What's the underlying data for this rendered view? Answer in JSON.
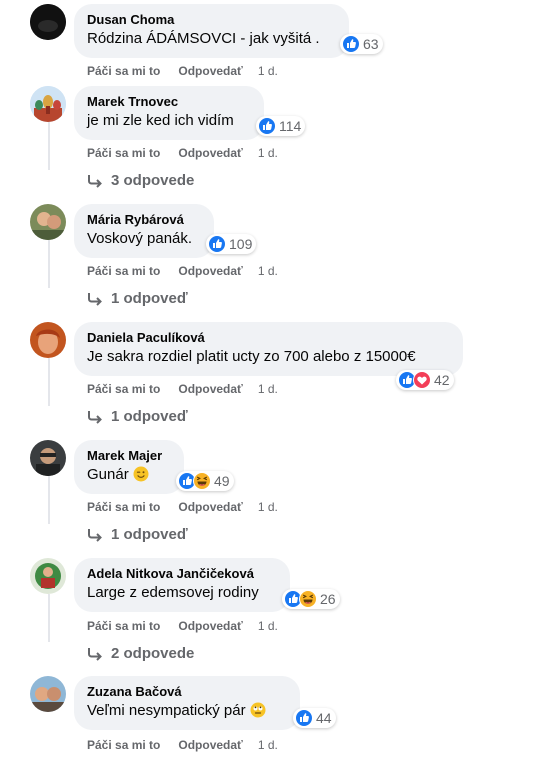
{
  "actions": {
    "like": "Páči sa mi to",
    "reply": "Odpovedať"
  },
  "colors": {
    "like_blue": "#1877f2",
    "love_red": "#f33e58",
    "haha_yellow": "#f7b125",
    "secondary_text": "#65676b",
    "bubble_bg": "#f0f2f5"
  },
  "comments": [
    {
      "author": "Dusan Choma",
      "text": "Ródzina ÁDÁMSOVCI - jak vyšitá .",
      "reactions": [
        "like"
      ],
      "count": "63",
      "time": "1 d.",
      "replies": ""
    },
    {
      "author": "Marek Trnovec",
      "text": "je mi zle ked ich vidím",
      "reactions": [
        "like"
      ],
      "count": "114",
      "time": "1 d.",
      "replies": "3 odpovede"
    },
    {
      "author": "Mária Rybárová",
      "text": "Voskový panák.",
      "reactions": [
        "like"
      ],
      "count": "109",
      "time": "1 d.",
      "replies": "1 odpoveď"
    },
    {
      "author": "Daniela Paculíková",
      "text": "Je sakra rozdiel platit ucty zo 700 alebo z 15000€",
      "reactions": [
        "like",
        "love"
      ],
      "count": "42",
      "time": "1 d.",
      "replies": "1 odpoveď"
    },
    {
      "author": "Marek Majer",
      "text": "Gunár",
      "emoji": "wink-emoji",
      "reactions": [
        "like",
        "haha"
      ],
      "count": "49",
      "time": "1 d.",
      "replies": "1 odpoveď"
    },
    {
      "author": "Adela Nitkova Jančičeková",
      "text": "Large z edemsovej rodiny",
      "reactions": [
        "like",
        "haha"
      ],
      "count": "26",
      "time": "1 d.",
      "replies": "2 odpovede"
    },
    {
      "author": "Zuzana Bačová",
      "text": "Veľmi nesympatický pár",
      "emoji": "eye-roll-emoji",
      "reactions": [
        "like"
      ],
      "count": "44",
      "time": "1 d.",
      "replies": ""
    }
  ]
}
